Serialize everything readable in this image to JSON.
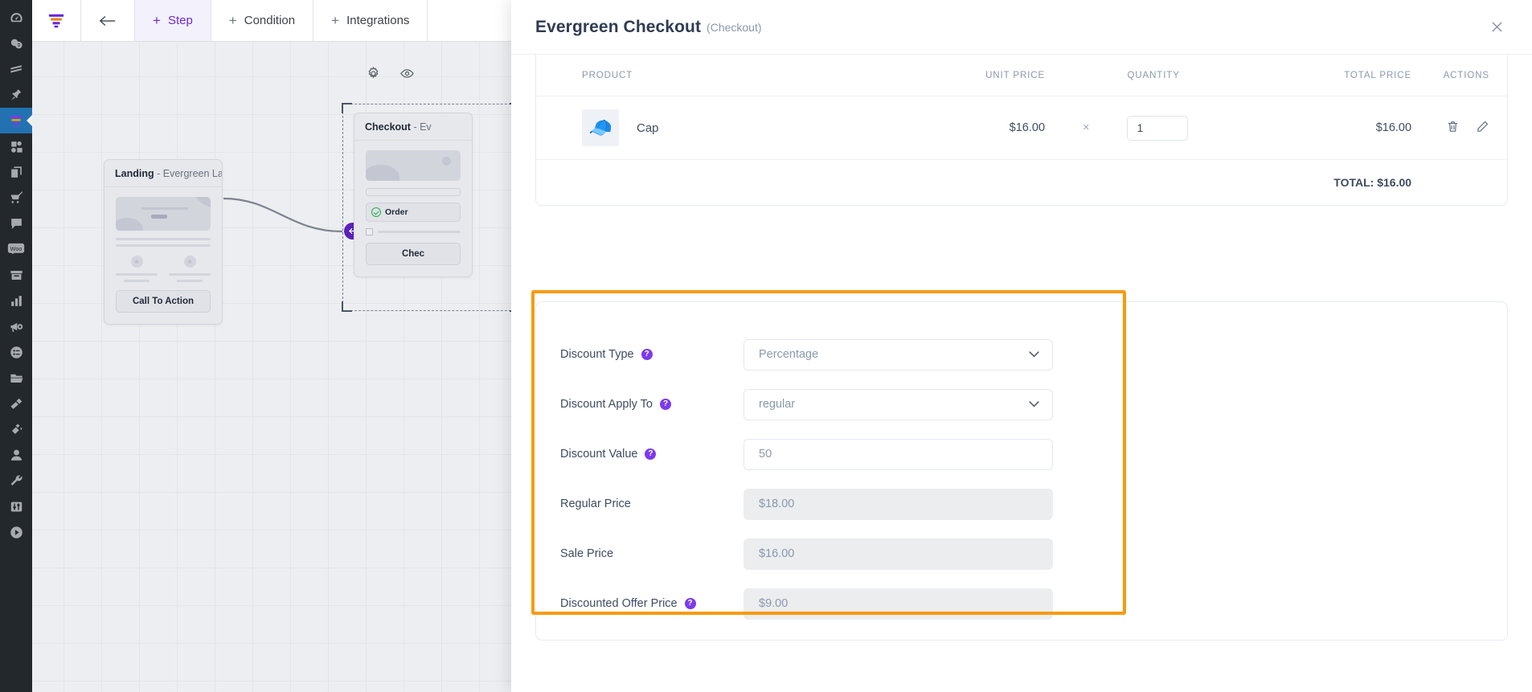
{
  "app": {
    "toolbar": {
      "logo_icon": "funnel-logo-icon",
      "back_label": "←",
      "items": [
        {
          "label": "Step",
          "plus": "+",
          "active": true
        },
        {
          "label": "Condition",
          "plus": "+",
          "active": false
        },
        {
          "label": "Integrations",
          "plus": "+",
          "active": false
        }
      ]
    },
    "rail_icons": [
      "dashboard-icon",
      "coins-icon",
      "layers-icon",
      "pin-icon",
      "funnel-icon",
      "media-icon",
      "copy-icon",
      "cart-icon",
      "comment-icon",
      "woo-icon",
      "archive-icon",
      "bar-chart-icon",
      "megaphone-icon",
      "list-circle-icon",
      "folder-icon",
      "brush-icon",
      "plug-icon",
      "user-icon",
      "wrench-icon",
      "sliders-icon",
      "play-icon"
    ],
    "canvas_tools": [
      "gear-icon",
      "eye-icon"
    ],
    "nodes": [
      {
        "type": "Landing",
        "separator": "-",
        "name": "Evergreen Lan...",
        "cta_label": "Call To Action"
      },
      {
        "type": "Checkout",
        "separator": "-",
        "name": "Ev",
        "order_label": "Order",
        "checkout_label": "Chec"
      }
    ]
  },
  "modal": {
    "title": "Evergreen Checkout",
    "subtitle": "(Checkout)",
    "close_icon": "close-icon",
    "product_table": {
      "headers": [
        "PRODUCT",
        "UNIT PRICE",
        "QUANTITY",
        "TOTAL PRICE",
        "ACTIONS"
      ],
      "rows": [
        {
          "thumb_icon": "cap-product-image",
          "product": "Cap",
          "unit_price": "$16.00",
          "multiplier": "×",
          "quantity": "1",
          "total_price": "$16.00",
          "actions": [
            "trash-icon",
            "pencil-icon"
          ]
        }
      ],
      "total_label": "TOTAL: $16.00"
    },
    "discount_form": {
      "highlight_color": "#f79b0e",
      "fields": [
        {
          "label": "Discount Type",
          "has_help": true,
          "control": "select",
          "value": "Percentage",
          "disabled": false
        },
        {
          "label": "Discount Apply To",
          "has_help": true,
          "control": "select",
          "value": "regular",
          "disabled": false
        },
        {
          "label": "Discount Value",
          "has_help": true,
          "control": "input",
          "value": "50",
          "disabled": false
        },
        {
          "label": "Regular Price",
          "has_help": false,
          "control": "input",
          "value": "$18.00",
          "disabled": true
        },
        {
          "label": "Sale Price",
          "has_help": false,
          "control": "input",
          "value": "$16.00",
          "disabled": true
        },
        {
          "label": "Discounted Offer Price",
          "has_help": true,
          "control": "input",
          "value": "$9.00",
          "disabled": true
        }
      ],
      "help_glyph": "?"
    }
  },
  "colors": {
    "accent_purple": "#6d28d9",
    "highlight_orange": "#f79b0e",
    "rail_dark": "#23282d",
    "rail_active_blue": "#2271b1"
  }
}
